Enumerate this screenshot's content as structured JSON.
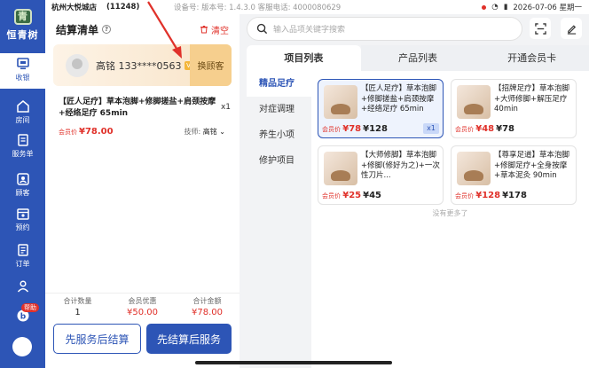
{
  "status": {
    "store": "杭州大悦城店",
    "code": "(11248)",
    "meta": "设备号:  版本号: 1.4.3.0  客服电话: 4000080629",
    "datetime": "2026-07-06 星期一"
  },
  "brand": {
    "mark": "青",
    "name": "恒青树"
  },
  "nav": [
    {
      "label": "收银",
      "icon": "cashier-icon"
    },
    {
      "label": "房间",
      "icon": "room-icon"
    },
    {
      "label": "服务单",
      "icon": "service-order-icon"
    },
    {
      "label": "顾客",
      "icon": "customer-icon"
    },
    {
      "label": "预约",
      "icon": "booking-icon"
    },
    {
      "label": "订单",
      "icon": "order-icon"
    },
    {
      "label": "",
      "icon": "users-icon"
    },
    {
      "label": "",
      "icon": "help-icon"
    }
  ],
  "help_badge": "帮助",
  "cart": {
    "title": "结算清单",
    "clear": "清空",
    "member_name": "高铭 133****0563",
    "vip": "V",
    "swap": "换顾客",
    "item": {
      "name": "【匠人足疗】草本泡脚+修脚搓盐+肩颈按摩+经络足疗 65min",
      "qty": "x1",
      "price_label": "会员价",
      "price": "¥78.00",
      "tech_label": "技师:",
      "tech_name": "高铭"
    },
    "summary": {
      "qty_label": "合计数量",
      "qty": "1",
      "discount_label": "会员优惠",
      "discount": "¥50.00",
      "total_label": "合计金额",
      "total": "¥78.00"
    },
    "btn_serve_first": "先服务后结算",
    "btn_pay_first": "先结算后服务"
  },
  "search": {
    "placeholder": "输入品项关键字搜索"
  },
  "tabs": [
    "项目列表",
    "产品列表",
    "开通会员卡"
  ],
  "categories": [
    "精品足疗",
    "对症调理",
    "养生小项",
    "修护项目"
  ],
  "cards": [
    {
      "title": "【匠人足疗】草本泡脚+修脚搓盐+肩颈按摩+经络足疗 65min",
      "member_label": "会员价",
      "member_price": "¥78",
      "price": "¥128",
      "badge": "x1"
    },
    {
      "title": "【招牌足疗】草本泡脚+大师修脚+解压足疗 40min",
      "member_label": "会员价",
      "member_price": "¥48",
      "price": "¥78",
      "badge": ""
    },
    {
      "title": "【大师修脚】草本泡脚+修脚(修好为之)+一次性刀片...",
      "member_label": "会员价",
      "member_price": "¥25",
      "price": "¥45",
      "badge": ""
    },
    {
      "title": "【尊享足道】草本泡脚+修脚足疗+全身按摩+草本泥灸 90min",
      "member_label": "会员价",
      "member_price": "¥128",
      "price": "¥178",
      "badge": ""
    }
  ],
  "no_more": "没有更多了",
  "colors": {
    "primary": "#2d55b6",
    "accent_red": "#e0312a",
    "member_gold": "#f6cf8e"
  }
}
